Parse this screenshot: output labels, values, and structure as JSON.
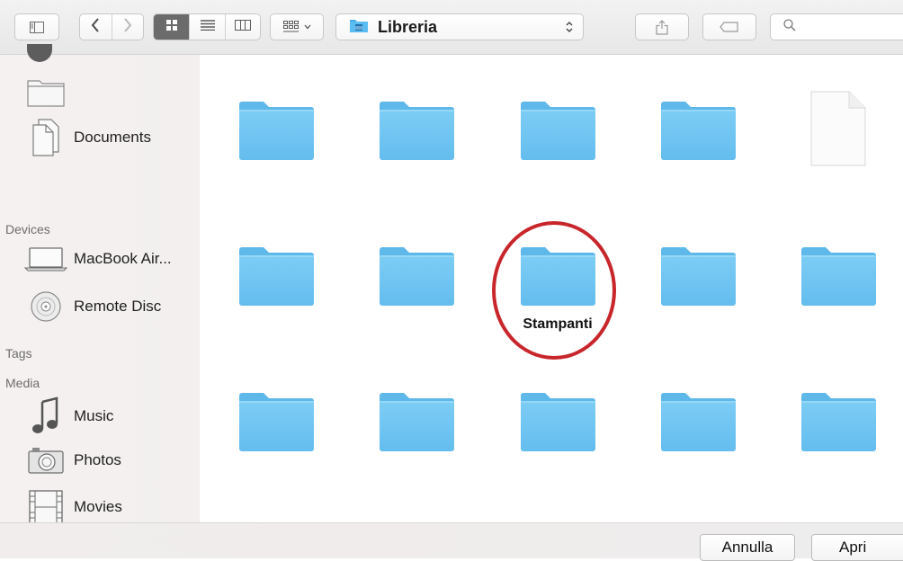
{
  "toolbar": {
    "path_label": "Libreria"
  },
  "sidebar": {
    "items_top": [
      {
        "label": "",
        "icon": "folder-outline-icon"
      },
      {
        "label": "Documents",
        "icon": "documents-icon"
      }
    ],
    "sections": [
      {
        "label": "Devices"
      },
      {
        "label": "Tags"
      },
      {
        "label": "Media"
      }
    ],
    "devices": [
      {
        "label": "MacBook Air...",
        "icon": "laptop-icon"
      },
      {
        "label": "Remote Disc",
        "icon": "disc-icon"
      }
    ],
    "media": [
      {
        "label": "Music",
        "icon": "music-note-icon"
      },
      {
        "label": "Photos",
        "icon": "camera-icon"
      },
      {
        "label": "Movies",
        "icon": "film-icon"
      }
    ]
  },
  "grid": {
    "highlighted_label": "Stampanti",
    "folder_color": "#6cc3f0",
    "highlight_color": "#c8262b"
  },
  "footer": {
    "cancel_label": "Annulla",
    "open_label": "Apri"
  }
}
